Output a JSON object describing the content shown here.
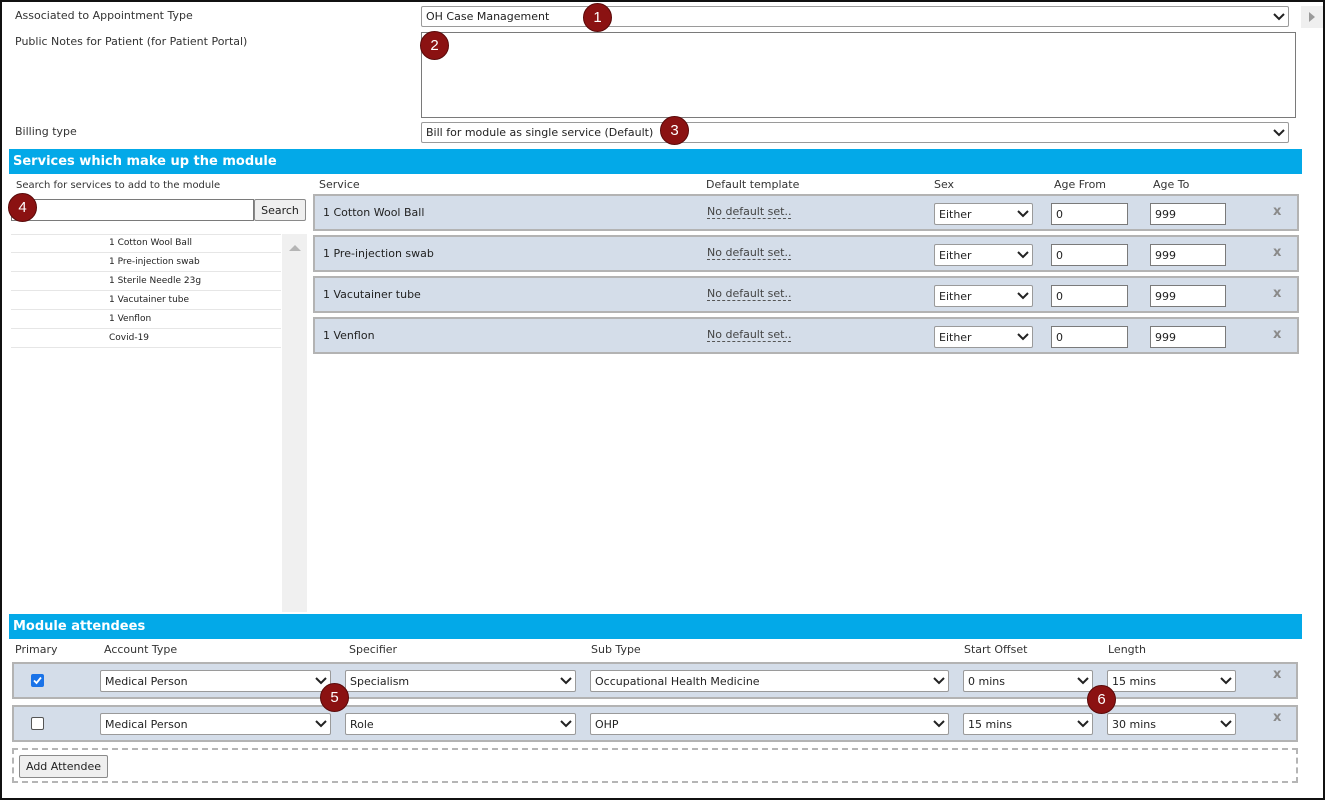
{
  "form": {
    "appointment_type_label": "Associated to Appointment Type",
    "appointment_type_value": "OH Case Management",
    "public_notes_label": "Public Notes for Patient (for Patient Portal)",
    "public_notes_value": "",
    "billing_type_label": "Billing type",
    "billing_type_value": "Bill for module as single service (Default)"
  },
  "badges": [
    "1",
    "2",
    "3",
    "4",
    "5",
    "6"
  ],
  "services_section": {
    "title": "Services which make up the module",
    "search_label": "Search for services to add to the module",
    "search_value": "",
    "search_button": "Search",
    "available_list": [
      "1 Cotton Wool Ball",
      "1 Pre-injection swab",
      "1 Sterile Needle 23g",
      "1 Vacutainer tube",
      "1 Venflon",
      "Covid-19"
    ],
    "columns": {
      "service": "Service",
      "default_template": "Default template",
      "sex": "Sex",
      "age_from": "Age From",
      "age_to": "Age To"
    },
    "rows": [
      {
        "service": "1 Cotton Wool Ball",
        "template": "No default set..",
        "sex": "Either",
        "age_from": "0",
        "age_to": "999"
      },
      {
        "service": "1 Pre-injection swab",
        "template": "No default set..",
        "sex": "Either",
        "age_from": "0",
        "age_to": "999"
      },
      {
        "service": "1 Vacutainer tube",
        "template": "No default set..",
        "sex": "Either",
        "age_from": "0",
        "age_to": "999"
      },
      {
        "service": "1 Venflon",
        "template": "No default set..",
        "sex": "Either",
        "age_from": "0",
        "age_to": "999"
      }
    ],
    "remove_glyph": "x"
  },
  "attendees_section": {
    "title": "Module attendees",
    "columns": {
      "primary": "Primary",
      "account_type": "Account Type",
      "specifier": "Specifier",
      "sub_type": "Sub Type",
      "start_offset": "Start Offset",
      "length": "Length"
    },
    "rows": [
      {
        "primary": true,
        "account_type": "Medical Person",
        "specifier": "Specialism",
        "sub_type": "Occupational Health Medicine",
        "start_offset": "0 mins",
        "length": "15 mins"
      },
      {
        "primary": false,
        "account_type": "Medical Person",
        "specifier": "Role",
        "sub_type": "OHP",
        "start_offset": "15 mins",
        "length": "30 mins"
      }
    ],
    "add_button": "Add Attendee",
    "remove_glyph": "x"
  },
  "colors": {
    "section_bar": "#03a9e8",
    "badge": "#8b1212",
    "row_background": "#d4dde9"
  },
  "icons": [
    "chevron-down-icon",
    "check-icon",
    "close-icon",
    "scroll-up-icon",
    "expand-right-icon"
  ]
}
